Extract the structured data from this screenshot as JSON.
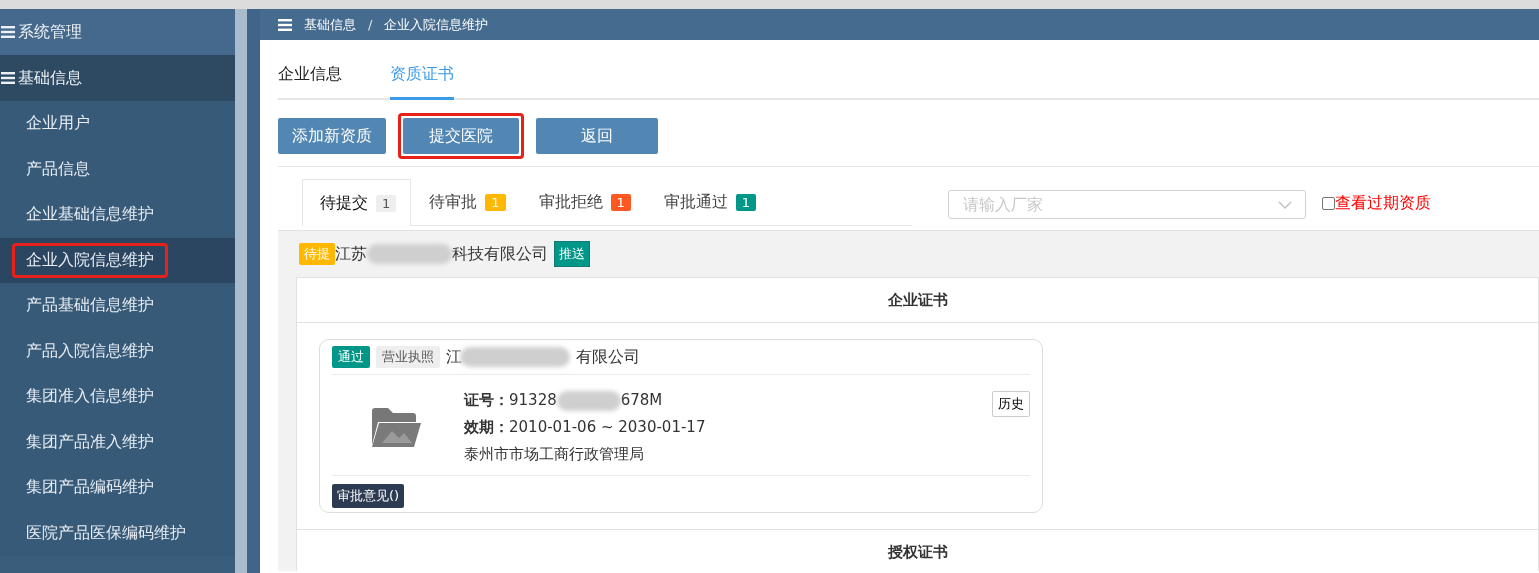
{
  "sidebar": {
    "groups": [
      {
        "label": "系统管理",
        "expanded": false
      },
      {
        "label": "基础信息",
        "expanded": true,
        "children": [
          {
            "label": "企业用户",
            "selected": false,
            "highlighted": false
          },
          {
            "label": "产品信息",
            "selected": false,
            "highlighted": false
          },
          {
            "label": "企业基础信息维护",
            "selected": false,
            "highlighted": false
          },
          {
            "label": "企业入院信息维护",
            "selected": true,
            "highlighted": true
          },
          {
            "label": "产品基础信息维护",
            "selected": false,
            "highlighted": false
          },
          {
            "label": "产品入院信息维护",
            "selected": false,
            "highlighted": false
          },
          {
            "label": "集团准入信息维护",
            "selected": false,
            "highlighted": false
          },
          {
            "label": "集团产品准入维护",
            "selected": false,
            "highlighted": false
          },
          {
            "label": "集团产品编码维护",
            "selected": false,
            "highlighted": false
          },
          {
            "label": "医院产品医保编码维护",
            "selected": false,
            "highlighted": false
          }
        ]
      }
    ]
  },
  "breadcrumb": {
    "items": [
      "基础信息",
      "企业入院信息维护"
    ],
    "separator": "/"
  },
  "page_tabs": [
    {
      "label": "企业信息",
      "selected": false
    },
    {
      "label": "资质证书",
      "selected": true
    }
  ],
  "buttons": [
    {
      "label": "添加新资质",
      "highlighted": false
    },
    {
      "label": "提交医院",
      "highlighted": true
    },
    {
      "label": "返回",
      "highlighted": false
    }
  ],
  "status_tabs": [
    {
      "label": "待提交",
      "count": "1",
      "color": "#eeeeee",
      "selected": true
    },
    {
      "label": "待审批",
      "count": "1",
      "color": "#ffb800",
      "selected": false
    },
    {
      "label": "审批拒绝",
      "count": "1",
      "color": "#ff5722",
      "selected": false
    },
    {
      "label": "审批通过",
      "count": "1",
      "color": "#009688",
      "selected": false
    }
  ],
  "filter": {
    "placeholder": "请输入厂家"
  },
  "expired_checkbox": {
    "label": "查看过期资质",
    "checked": false
  },
  "company": {
    "status": "待提",
    "name_parts": [
      "江苏",
      "科技有限公司"
    ],
    "action": "推送"
  },
  "sections": [
    {
      "title": "企业证书",
      "certificates": [
        {
          "status": "通过",
          "type": "营业执照",
          "name_parts": [
            "江",
            "有限公司"
          ],
          "number_label": "证号：",
          "number_parts": [
            "91328",
            "678M"
          ],
          "validity_label": "效期：",
          "validity": "2010-01-06 ~ 2030-01-17",
          "issuer": "泰州市市场工商行政管理局",
          "history": "历史",
          "opinion": "审批意见()"
        }
      ]
    },
    {
      "title": "授权证书"
    }
  ]
}
